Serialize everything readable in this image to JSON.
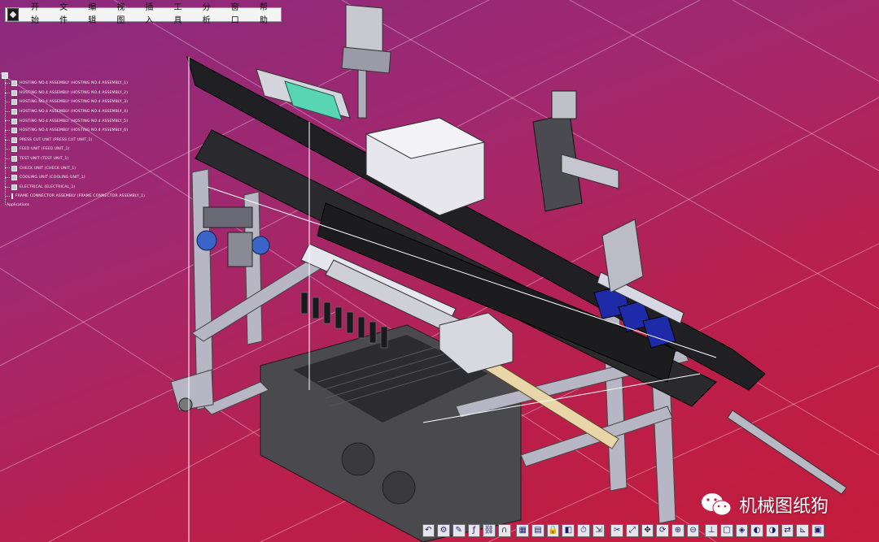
{
  "menubar": {
    "items": [
      "开始",
      "文件",
      "编辑",
      "视图",
      "插入",
      "工具",
      "分析",
      "窗口",
      "帮助"
    ]
  },
  "spec_tree": {
    "root": "",
    "nodes": [
      "HOSTING NO.4 ASSEMBLY (HOSTING NO.4 ASSEMBLY_1)",
      "HOSTING NO.4 ASSEMBLY (HOSTING NO.4 ASSEMBLY_2)",
      "HOSTING NO.4 ASSEMBLY (HOSTING NO.4 ASSEMBLY_3)",
      "HOSTING NO.4 ASSEMBLY (HOSTING NO.4 ASSEMBLY_4)",
      "HOSTING NO.4 ASSEMBLY (HOSTING NO.4 ASSEMBLY_5)",
      "HOSTING NO.4 ASSEMBLY (HOSTING NO.4 ASSEMBLY_6)",
      "PRESS CUT UNIT (PRESS CUT UNIT_1)",
      "FEED UNIT (FEED UNIT_1)",
      "TEST UNIT (TEST UNIT_1)",
      "CHECK UNIT (CHECK UNIT_1)",
      "COOLING UNIT (COOLING UNIT_1)",
      "ELECTRICAL (ELECTRICAL_1)",
      "FRAME CONNECTOR ASSEMBLY (FRAME CONNECTOR ASSEMBLY_1)"
    ],
    "tail": "Applications"
  },
  "toolbar": {
    "icons": [
      "undo-icon",
      "assembly-icon",
      "sketch-icon",
      "formula-icon",
      "link-icon",
      "magnet-icon",
      "grid-icon",
      "table-icon",
      "lock-icon",
      "catalog-icon",
      "clock-icon",
      "measure-icon",
      "scissors-icon",
      "fit-all-icon",
      "pan-icon",
      "rotate-icon",
      "zoom-in-icon",
      "zoom-out-icon",
      "normal-view-icon",
      "create-view-icon",
      "iso-view-icon",
      "shading-icon",
      "hide-show-icon",
      "swap-visible-icon",
      "axis-icon",
      "material-icon"
    ],
    "glyphs": [
      "↶",
      "⚙",
      "✎",
      "ƒ",
      "⛓",
      "∩",
      "▦",
      "▤",
      "🔒",
      "◧",
      "⏱",
      "⇲",
      "✂",
      "⤢",
      "✥",
      "⟳",
      "⊕",
      "⊖",
      "⊥",
      "▢",
      "◈",
      "◐",
      "◑",
      "⇄",
      "⊾",
      "▣"
    ]
  },
  "watermark": {
    "text": "机械图纸狗"
  },
  "colors": {
    "bg_top": "#8a2a7e",
    "bg_bottom": "#c41c3a",
    "menubar": "#f4f4f4"
  }
}
